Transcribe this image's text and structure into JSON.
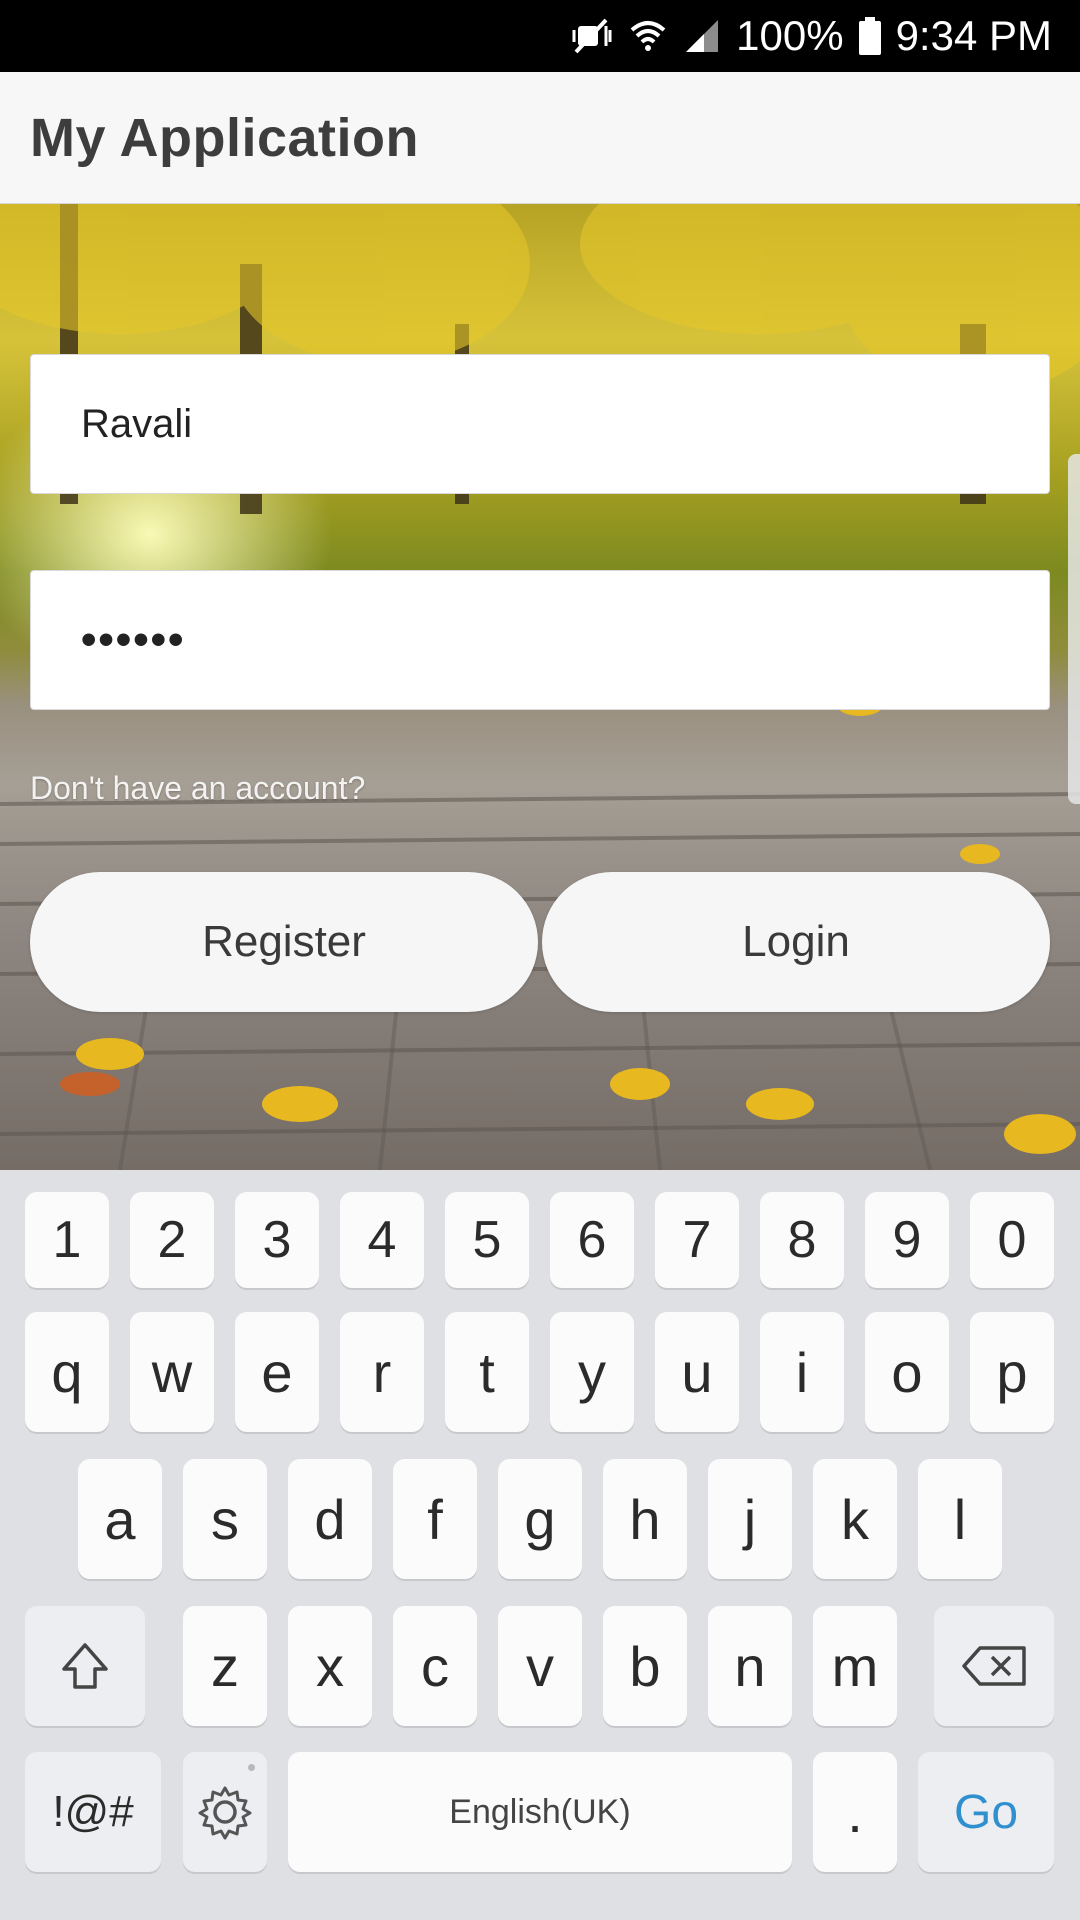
{
  "status_bar": {
    "battery": "100%",
    "time": "9:34 PM",
    "icons": [
      "mute-icon",
      "wifi-icon",
      "signal-icon",
      "battery-icon"
    ]
  },
  "app": {
    "title": "My Application"
  },
  "form": {
    "username_value": "Ravali",
    "password_value": "••••••",
    "signup_hint": "Don't have an account?",
    "register_label": "Register",
    "login_label": "Login"
  },
  "keyboard": {
    "numbers": [
      "1",
      "2",
      "3",
      "4",
      "5",
      "6",
      "7",
      "8",
      "9",
      "0"
    ],
    "row1": [
      "q",
      "w",
      "e",
      "r",
      "t",
      "y",
      "u",
      "i",
      "o",
      "p"
    ],
    "row2": [
      "a",
      "s",
      "d",
      "f",
      "g",
      "h",
      "j",
      "k",
      "l"
    ],
    "row3": [
      "z",
      "x",
      "c",
      "v",
      "b",
      "n",
      "m"
    ],
    "symbols_label": "!@#",
    "space_label": "English(UK)",
    "period_label": ".",
    "go_label": "Go",
    "accent_color": "#2f8fcf"
  }
}
